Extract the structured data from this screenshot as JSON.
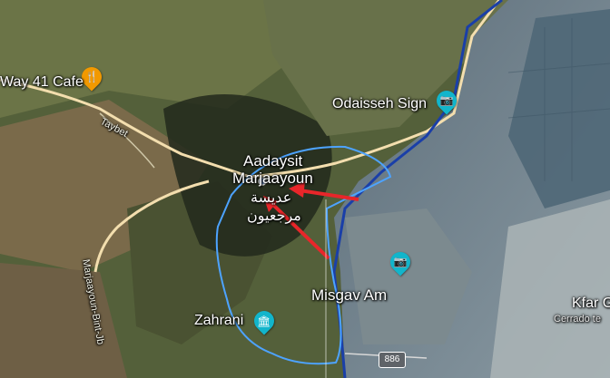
{
  "map": {
    "places": {
      "cafe": "Way 41 Cafe",
      "odaisseh": "Odaisseh Sign",
      "aadaysit": "Aadaysit",
      "marjaayoun": "Marjaayoun",
      "arabic_line1": "عديسة",
      "arabic_line2": "مرجعيون",
      "misgav": "Misgav Am",
      "zahrani": "Zahrani",
      "kfar": "Kfar G",
      "cerrado": "Cerrado te"
    },
    "roads": {
      "taybet": "Taybet",
      "marjaayoun_bint": "Marjaayoun-Bint-Jb",
      "route_886": "886"
    },
    "icons": {
      "cafe": "cafe-icon",
      "camera": "camera-icon",
      "museum": "museum-icon"
    },
    "colors": {
      "border_line": "#1a3fa8",
      "region_outline": "#4da3ff",
      "arrows": "#e8262a",
      "pin_food": "#f29900",
      "pin_photo": "#12b5cb",
      "pin_museum": "#12b5cb",
      "road": "#f3deae"
    }
  }
}
